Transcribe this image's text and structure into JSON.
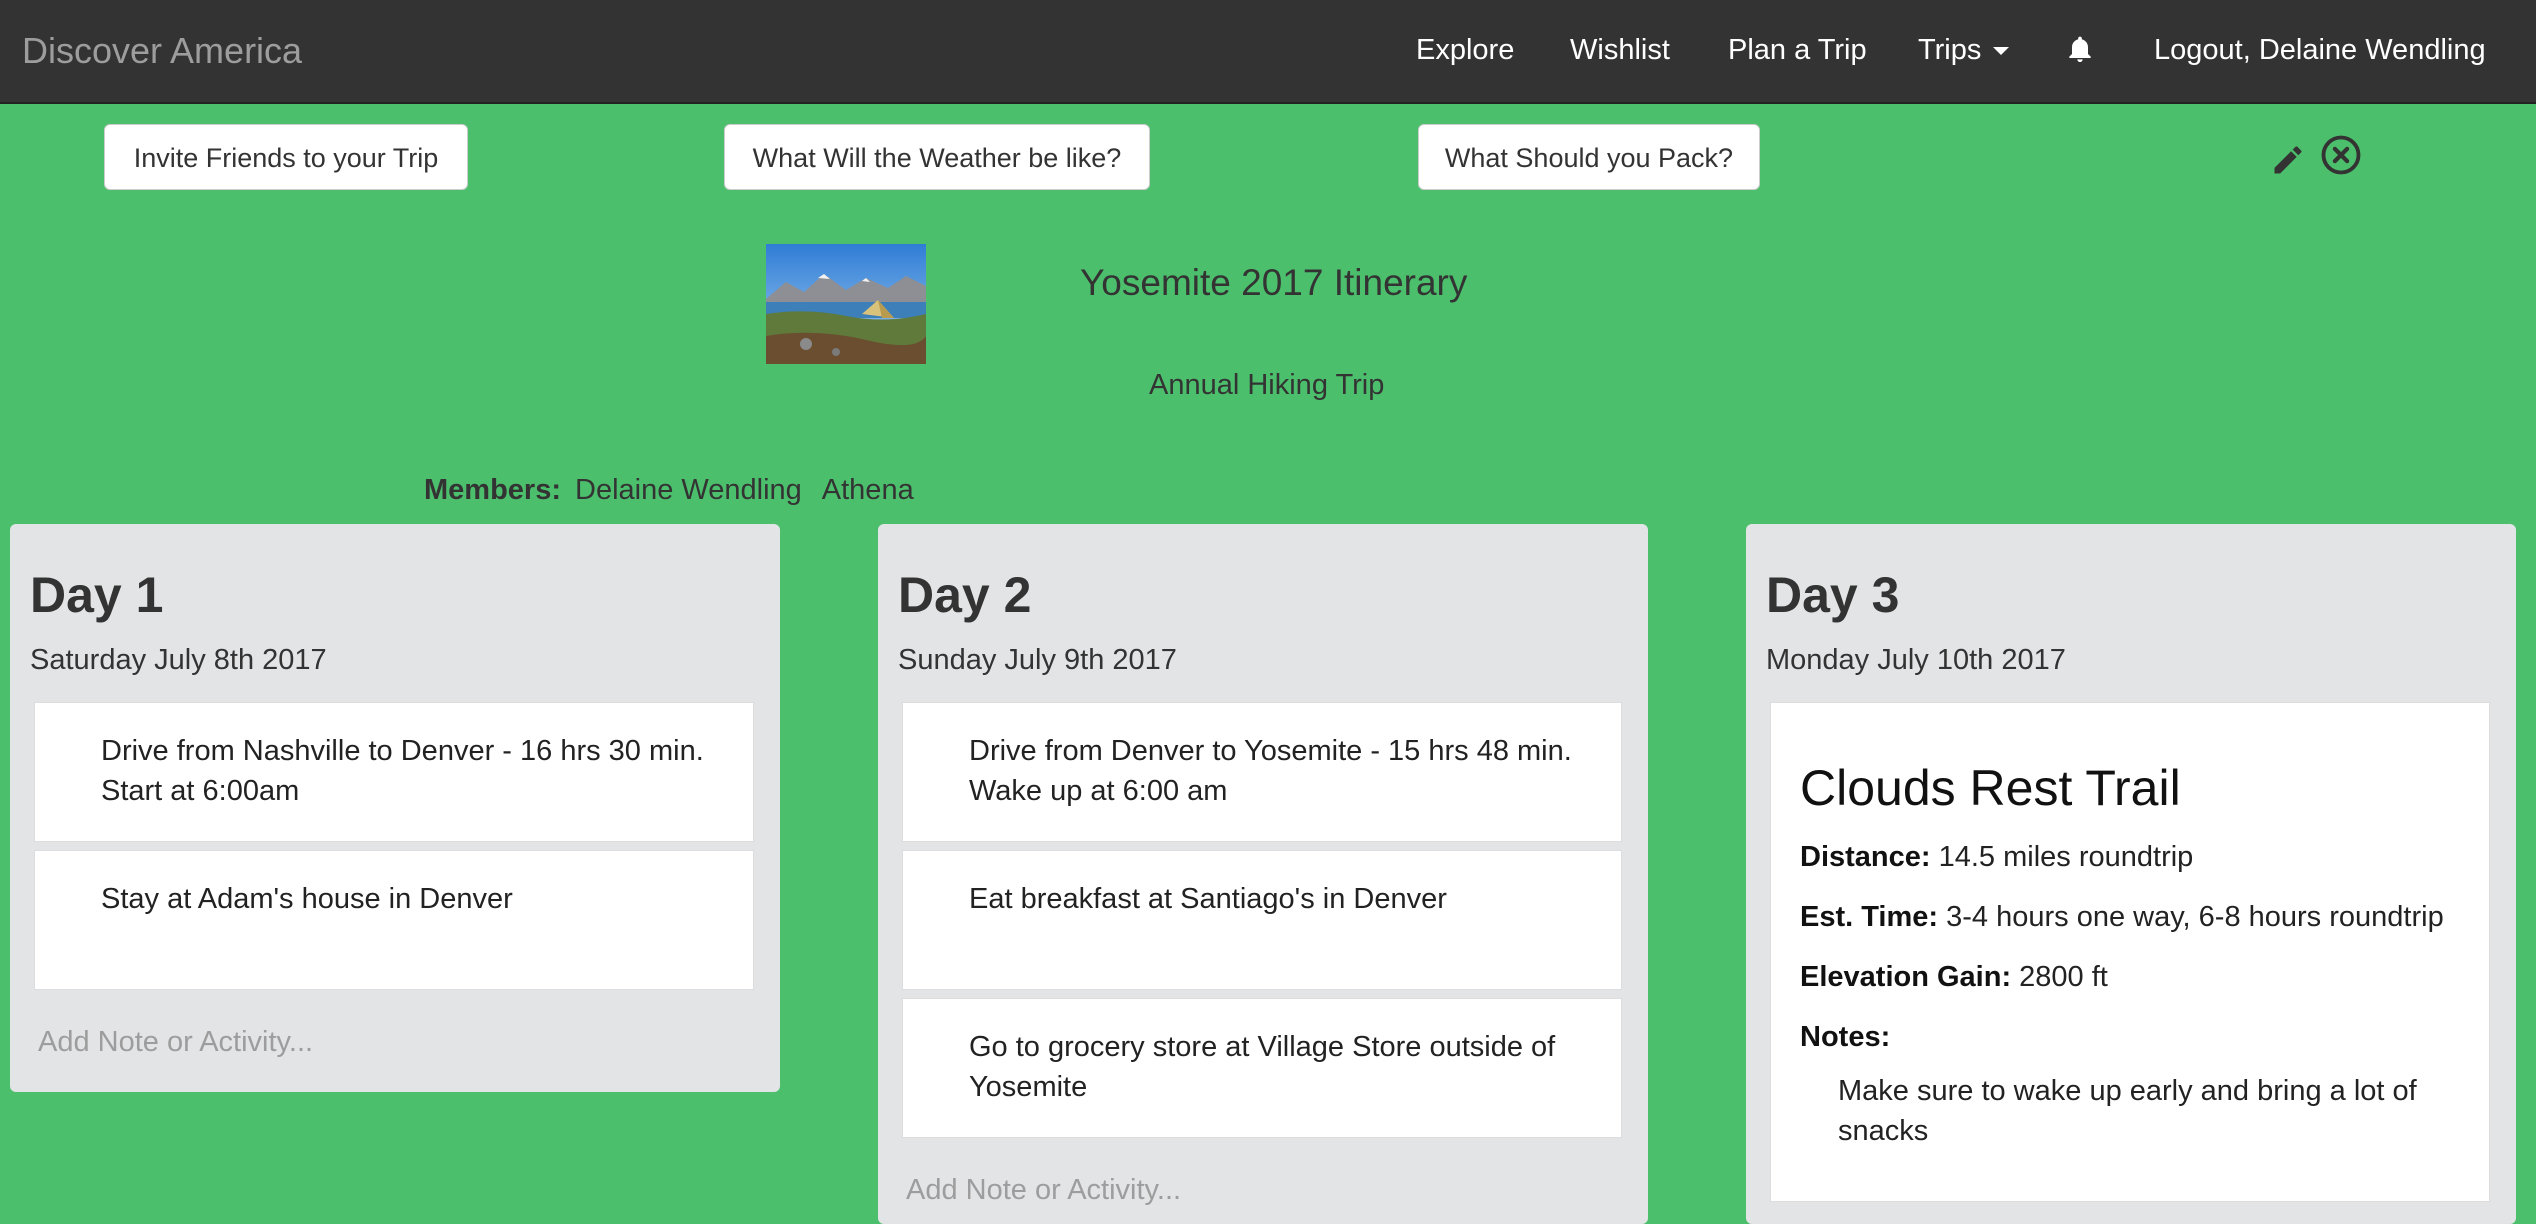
{
  "navbar": {
    "brand": "Discover America",
    "items": [
      {
        "label": "Explore"
      },
      {
        "label": "Wishlist"
      },
      {
        "label": "Plan a Trip"
      },
      {
        "label": "Trips"
      },
      {
        "label": "Logout, Delaine Wendling"
      }
    ],
    "bell_icon": "bell-icon"
  },
  "toolbar": {
    "invite_label": "Invite Friends to your Trip",
    "weather_label": "What Will the Weather be like?",
    "pack_label": "What Should you Pack?",
    "edit_icon": "pencil-icon",
    "close_icon": "close-circle-icon"
  },
  "trip": {
    "title": "Yosemite 2017 Itinerary",
    "subtitle": "Annual Hiking Trip",
    "members_label": "Members:",
    "members": [
      "Delaine Wendling",
      "Athena"
    ]
  },
  "days": [
    {
      "title": "Day 1",
      "date": "Saturday July 8th 2017",
      "activities": [
        "Drive from Nashville to Denver - 16 hrs 30 min. Start at 6:00am",
        "Stay at Adam's house in Denver"
      ],
      "add_placeholder": "Add Note or Activity..."
    },
    {
      "title": "Day 2",
      "date": "Sunday July 9th 2017",
      "activities": [
        "Drive from Denver to Yosemite - 15 hrs 48 min. Wake up at 6:00 am",
        "Eat breakfast at Santiago's in Denver",
        "Go to grocery store at Village Store outside of Yosemite"
      ],
      "add_placeholder": "Add Note or Activity..."
    },
    {
      "title": "Day 3",
      "date": "Monday July 10th 2017",
      "detail": {
        "title": "Clouds Rest Trail",
        "distance_label": "Distance:",
        "distance": "14.5 miles roundtrip",
        "time_label": "Est. Time:",
        "time": "3-4 hours one way, 6-8 hours roundtrip",
        "elevation_label": "Elevation Gain:",
        "elevation": "2800 ft",
        "notes_label": "Notes:",
        "notes": "Make sure to wake up early and bring a lot of snacks"
      }
    }
  ],
  "colors": {
    "page_bg": "#4cbf6c",
    "navbar_bg": "#333333",
    "card_bg": "#e3e4e6"
  }
}
